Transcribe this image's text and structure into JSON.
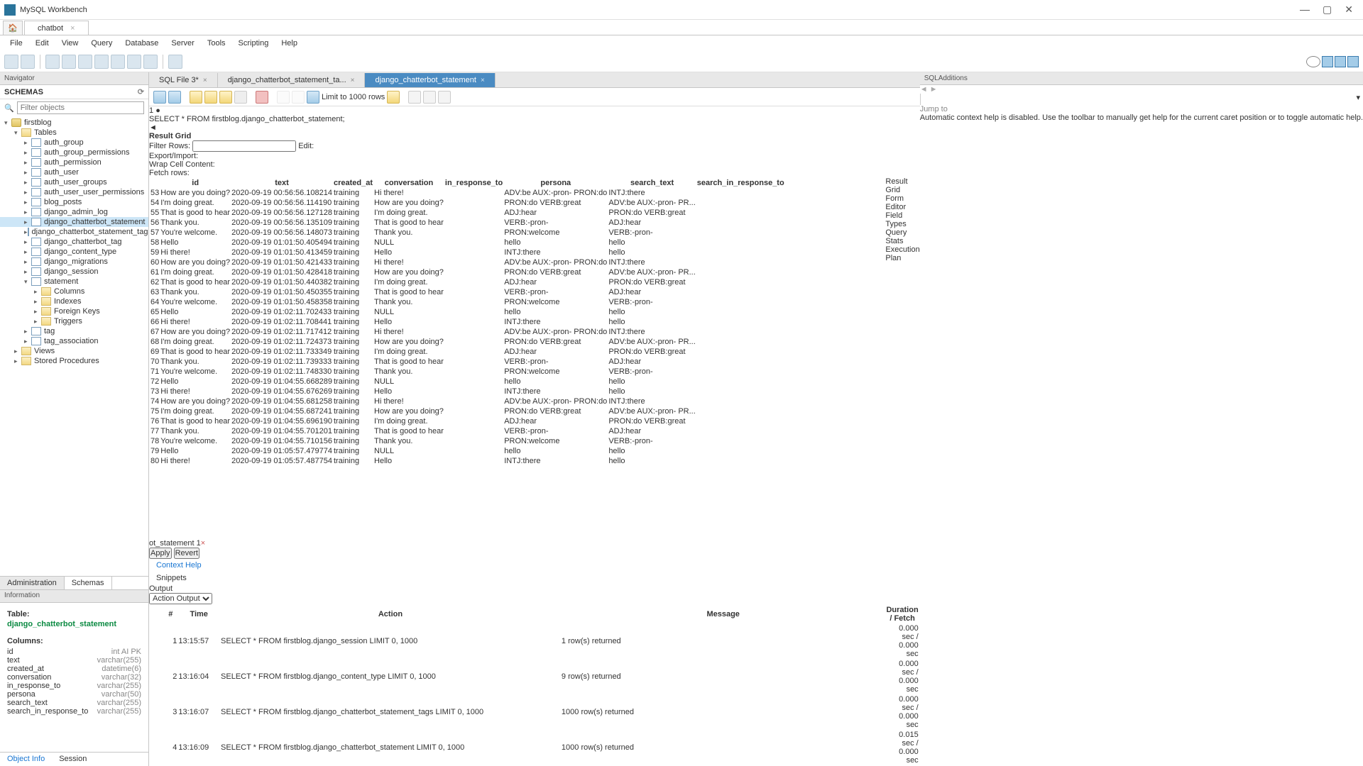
{
  "app_title": "MySQL Workbench",
  "connection_tab": "chatbot",
  "menu": [
    "File",
    "Edit",
    "View",
    "Query",
    "Database",
    "Server",
    "Tools",
    "Scripting",
    "Help"
  ],
  "navigator": {
    "title": "Navigator",
    "schemas": "SCHEMAS",
    "filter_placeholder": "Filter objects"
  },
  "tree_db": "firstblog",
  "tree_tables": "Tables",
  "tree_items": [
    "auth_group",
    "auth_group_permissions",
    "auth_permission",
    "auth_user",
    "auth_user_groups",
    "auth_user_user_permissions",
    "blog_posts",
    "django_admin_log",
    "django_chatterbot_statement",
    "django_chatterbot_statement_tags",
    "django_chatterbot_tag",
    "django_content_type",
    "django_migrations",
    "django_session"
  ],
  "tree_statement": "statement",
  "tree_sub": [
    "Columns",
    "Indexes",
    "Foreign Keys",
    "Triggers"
  ],
  "tree_after": [
    "tag",
    "tag_association"
  ],
  "tree_bottom": [
    "Views",
    "Stored Procedures"
  ],
  "nav_tabs": {
    "admin": "Administration",
    "schemas": "Schemas"
  },
  "info_hdr": "Information",
  "info": {
    "table_lbl": "Table:",
    "table_name": "django_chatterbot_statement",
    "cols_lbl": "Columns:",
    "cols": [
      [
        "id",
        "int AI PK"
      ],
      [
        "text",
        "varchar(255)"
      ],
      [
        "created_at",
        "datetime(6)"
      ],
      [
        "conversation",
        "varchar(32)"
      ],
      [
        "in_response_to",
        "varchar(255)"
      ],
      [
        "persona",
        "varchar(50)"
      ],
      [
        "search_text",
        "varchar(255)"
      ],
      [
        "search_in_response_to",
        "varchar(255)"
      ]
    ]
  },
  "bottom_tabs": {
    "obj": "Object Info",
    "sess": "Session"
  },
  "editor_tabs": [
    {
      "label": "SQL File 3*"
    },
    {
      "label": "django_chatterbot_statement_ta..."
    },
    {
      "label": "django_chatterbot_statement",
      "active": true
    }
  ],
  "limit": "Limit to 1000 rows",
  "sql_line": "1",
  "sql": {
    "kw1": "SELECT",
    "star": "*",
    "kw2": "FROM",
    "rest": "firstblog.django_chatterbot_statement;"
  },
  "result_bar": {
    "grid": "Result Grid",
    "filter": "Filter Rows:",
    "edit": "Edit:",
    "ei": "Export/Import:",
    "wrap": "Wrap Cell Content:",
    "fetch": "Fetch rows:"
  },
  "grid_headers": [
    "id",
    "text",
    "created_at",
    "conversation",
    "in_response_to",
    "persona",
    "search_text",
    "search_in_response_to"
  ],
  "rows": [
    [
      "53",
      "How are you doing?",
      "2020-09-19 00:56:56.108214",
      "training",
      "Hi there!",
      "",
      "ADV:be AUX:-pron- PRON:do",
      "INTJ:there"
    ],
    [
      "54",
      "I'm doing great.",
      "2020-09-19 00:56:56.114190",
      "training",
      "How are you doing?",
      "",
      "PRON:do VERB:great",
      "ADV:be AUX:-pron- PR..."
    ],
    [
      "55",
      "That is good to hear",
      "2020-09-19 00:56:56.127128",
      "training",
      "I'm doing great.",
      "",
      "ADJ:hear",
      "PRON:do VERB:great"
    ],
    [
      "56",
      "Thank you.",
      "2020-09-19 00:56:56.135109",
      "training",
      "That is good to hear",
      "",
      "VERB:-pron-",
      "ADJ:hear"
    ],
    [
      "57",
      "You're welcome.",
      "2020-09-19 00:56:56.148073",
      "training",
      "Thank you.",
      "",
      "PRON:welcome",
      "VERB:-pron-"
    ],
    [
      "58",
      "Hello",
      "2020-09-19 01:01:50.405494",
      "training",
      "NULL",
      "",
      "hello",
      "hello"
    ],
    [
      "59",
      "Hi there!",
      "2020-09-19 01:01:50.413459",
      "training",
      "Hello",
      "",
      "INTJ:there",
      "hello"
    ],
    [
      "60",
      "How are you doing?",
      "2020-09-19 01:01:50.421433",
      "training",
      "Hi there!",
      "",
      "ADV:be AUX:-pron- PRON:do",
      "INTJ:there"
    ],
    [
      "61",
      "I'm doing great.",
      "2020-09-19 01:01:50.428418",
      "training",
      "How are you doing?",
      "",
      "PRON:do VERB:great",
      "ADV:be AUX:-pron- PR..."
    ],
    [
      "62",
      "That is good to hear",
      "2020-09-19 01:01:50.440382",
      "training",
      "I'm doing great.",
      "",
      "ADJ:hear",
      "PRON:do VERB:great"
    ],
    [
      "63",
      "Thank you.",
      "2020-09-19 01:01:50.450355",
      "training",
      "That is good to hear",
      "",
      "VERB:-pron-",
      "ADJ:hear"
    ],
    [
      "64",
      "You're welcome.",
      "2020-09-19 01:01:50.458358",
      "training",
      "Thank you.",
      "",
      "PRON:welcome",
      "VERB:-pron-"
    ],
    [
      "65",
      "Hello",
      "2020-09-19 01:02:11.702433",
      "training",
      "NULL",
      "",
      "hello",
      "hello"
    ],
    [
      "66",
      "Hi there!",
      "2020-09-19 01:02:11.708441",
      "training",
      "Hello",
      "",
      "INTJ:there",
      "hello"
    ],
    [
      "67",
      "How are you doing?",
      "2020-09-19 01:02:11.717412",
      "training",
      "Hi there!",
      "",
      "ADV:be AUX:-pron- PRON:do",
      "INTJ:there"
    ],
    [
      "68",
      "I'm doing great.",
      "2020-09-19 01:02:11.724373",
      "training",
      "How are you doing?",
      "",
      "PRON:do VERB:great",
      "ADV:be AUX:-pron- PR..."
    ],
    [
      "69",
      "That is good to hear",
      "2020-09-19 01:02:11.733349",
      "training",
      "I'm doing great.",
      "",
      "ADJ:hear",
      "PRON:do VERB:great"
    ],
    [
      "70",
      "Thank you.",
      "2020-09-19 01:02:11.739333",
      "training",
      "That is good to hear",
      "",
      "VERB:-pron-",
      "ADJ:hear"
    ],
    [
      "71",
      "You're welcome.",
      "2020-09-19 01:02:11.748330",
      "training",
      "Thank you.",
      "",
      "PRON:welcome",
      "VERB:-pron-"
    ],
    [
      "72",
      "Hello",
      "2020-09-19 01:04:55.668289",
      "training",
      "NULL",
      "",
      "hello",
      "hello"
    ],
    [
      "73",
      "Hi there!",
      "2020-09-19 01:04:55.676269",
      "training",
      "Hello",
      "",
      "INTJ:there",
      "hello"
    ],
    [
      "74",
      "How are you doing?",
      "2020-09-19 01:04:55.681258",
      "training",
      "Hi there!",
      "",
      "ADV:be AUX:-pron- PRON:do",
      "INTJ:there"
    ],
    [
      "75",
      "I'm doing great.",
      "2020-09-19 01:04:55.687241",
      "training",
      "How are you doing?",
      "",
      "PRON:do VERB:great",
      "ADV:be AUX:-pron- PR..."
    ],
    [
      "76",
      "That is good to hear",
      "2020-09-19 01:04:55.696190",
      "training",
      "I'm doing great.",
      "",
      "ADJ:hear",
      "PRON:do VERB:great"
    ],
    [
      "77",
      "Thank you.",
      "2020-09-19 01:04:55.701201",
      "training",
      "That is good to hear",
      "",
      "VERB:-pron-",
      "ADJ:hear"
    ],
    [
      "78",
      "You're welcome.",
      "2020-09-19 01:04:55.710156",
      "training",
      "Thank you.",
      "",
      "PRON:welcome",
      "VERB:-pron-"
    ],
    [
      "79",
      "Hello",
      "2020-09-19 01:05:57.479774",
      "training",
      "NULL",
      "",
      "hello",
      "hello"
    ],
    [
      "80",
      "Hi there!",
      "2020-09-19 01:05:57.487754",
      "training",
      "Hello",
      "",
      "INTJ:there",
      "hello"
    ]
  ],
  "side_tabs": [
    "Result Grid",
    "Form Editor",
    "Field Types",
    "Query Stats",
    "Execution Plan"
  ],
  "result_tab": "ot_statement 1",
  "apply": "Apply",
  "revert": "Revert",
  "right_tabs": {
    "ctx": "Context Help",
    "snip": "Snippets"
  },
  "output": {
    "hdr": "Output",
    "sel": "Action Output",
    "cols": [
      "#",
      "Time",
      "Action",
      "Message",
      "Duration / Fetch"
    ],
    "rows": [
      [
        "1",
        "13:15:57",
        "SELECT * FROM firstblog.django_session LIMIT 0, 1000",
        "1 row(s) returned",
        "0.000 sec / 0.000 sec"
      ],
      [
        "2",
        "13:16:04",
        "SELECT * FROM firstblog.django_content_type LIMIT 0, 1000",
        "9 row(s) returned",
        "0.000 sec / 0.000 sec"
      ],
      [
        "3",
        "13:16:07",
        "SELECT * FROM firstblog.django_chatterbot_statement_tags LIMIT 0, 1000",
        "1000 row(s) returned",
        "0.000 sec / 0.000 sec"
      ],
      [
        "4",
        "13:16:09",
        "SELECT * FROM firstblog.django_chatterbot_statement LIMIT 0, 1000",
        "1000 row(s) returned",
        "0.015 sec / 0.000 sec"
      ]
    ]
  },
  "sql_add": {
    "hdr": "SQLAdditions",
    "jump": "Jump to",
    "help": "Automatic context help is disabled. Use the toolbar to manually get help for the current caret position or to toggle automatic help."
  }
}
